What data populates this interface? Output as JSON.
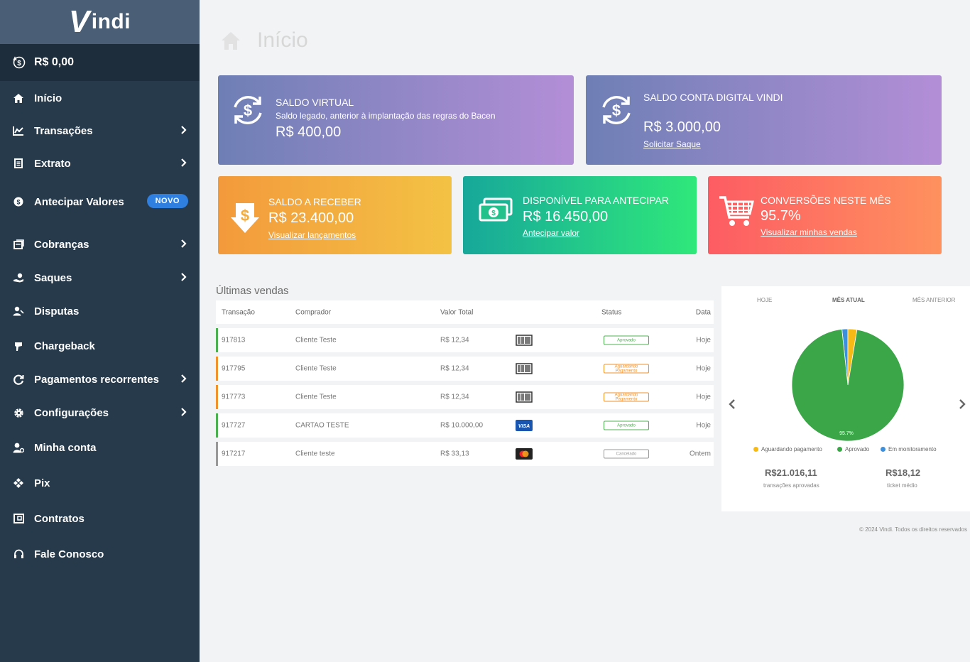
{
  "brand": {
    "logo_letter": "V",
    "logo_text": "indi"
  },
  "sidebar": {
    "balance": "R$ 0,00",
    "items": [
      {
        "label": "Início",
        "icon": "home-icon"
      },
      {
        "label": "Transações",
        "icon": "chart-line-icon"
      },
      {
        "label": "Extrato",
        "icon": "document-icon"
      },
      {
        "label": "Antecipar Valores",
        "icon": "dollar-circle-icon",
        "badge": "NOVO"
      },
      {
        "label": "Cobranças",
        "icon": "invoice-icon"
      },
      {
        "label": "Saques",
        "icon": "withdraw-icon"
      },
      {
        "label": "Disputas",
        "icon": "user-dispute-icon"
      },
      {
        "label": "Chargeback",
        "icon": "hand-icon"
      },
      {
        "label": "Pagamentos recorrentes",
        "icon": "refresh-icon"
      },
      {
        "label": "Configurações",
        "icon": "gear-icon"
      },
      {
        "label": "Minha conta",
        "icon": "user-icon"
      },
      {
        "label": "Pix",
        "icon": "pix-icon"
      },
      {
        "label": "Contratos",
        "icon": "contract-icon"
      },
      {
        "label": "Fale Conosco",
        "icon": "headset-icon"
      }
    ]
  },
  "page": {
    "title": "Início"
  },
  "cards": {
    "virtual": {
      "label": "SALDO VIRTUAL",
      "sub": "Saldo legado, anterior à implantação das regras do Bacen",
      "value": "R$ 400,00"
    },
    "digital": {
      "label": "SALDO CONTA DIGITAL VINDI",
      "value": "R$ 3.000,00",
      "link": "Solicitar Saque"
    },
    "receive": {
      "label": "SALDO A RECEBER",
      "value": "R$ 23.400,00",
      "link": "Visualizar lançamentos"
    },
    "anticipate": {
      "label": "DISPONÍVEL PARA ANTECIPAR",
      "value": "R$ 16.450,00",
      "link": "Antecipar valor"
    },
    "conversion": {
      "label": "CONVERSÕES NESTE MÊS",
      "value": "95.7%",
      "link": "Visualizar minhas vendas"
    }
  },
  "sales": {
    "title": "Últimas vendas",
    "headers": {
      "transaction": "Transação",
      "buyer": "Comprador",
      "total": "Valor Total",
      "status": "Status",
      "date": "Data"
    },
    "rows": [
      {
        "id": "917813",
        "buyer": "Cliente Teste",
        "total": "R$ 12,34",
        "pay": "boleto",
        "status": "Aprovado",
        "status_kind": "ok",
        "date": "Hoje",
        "color": "#4cb050"
      },
      {
        "id": "917795",
        "buyer": "Cliente Teste",
        "total": "R$ 12,34",
        "pay": "boleto",
        "status": "Aguardando Pagamento",
        "status_kind": "wait",
        "date": "Hoje",
        "color": "#f0932c"
      },
      {
        "id": "917773",
        "buyer": "Cliente Teste",
        "total": "R$ 12,34",
        "pay": "boleto",
        "status": "Aguardando Pagamento",
        "status_kind": "wait",
        "date": "Hoje",
        "color": "#f0932c"
      },
      {
        "id": "917727",
        "buyer": "CARTAO TESTE",
        "total": "R$ 10.000,00",
        "pay": "visa",
        "status": "Aprovado",
        "status_kind": "ok",
        "date": "Hoje",
        "color": "#4cb050"
      },
      {
        "id": "917217",
        "buyer": "Cliente teste",
        "total": "R$ 33,13",
        "pay": "mastercard",
        "status": "Cancelado",
        "status_kind": "cancel",
        "date": "Ontem",
        "color": "#999999"
      }
    ]
  },
  "panel": {
    "tabs": [
      "HOJE",
      "MÊS ATUAL",
      "MÊS ANTERIOR"
    ],
    "active_tab": "MÊS ATUAL",
    "approved_total": "R$21.016,11",
    "approved_label": "transações aprovadas",
    "avg_ticket": "R$18,12",
    "avg_label": "ticket médio"
  },
  "chart_data": {
    "type": "pie",
    "series": [
      {
        "name": "Aguardando pagamento",
        "value": 2.6,
        "color": "#f6b915"
      },
      {
        "name": "Aprovado",
        "value": 95.7,
        "color": "#3aa648"
      },
      {
        "name": "Em monitoramento",
        "value": 1.7,
        "color": "#3c8fdd"
      }
    ],
    "data_label": "95.7%",
    "legend": "bottom"
  },
  "footer": "© 2024 Vindi. Todos os direitos reservados"
}
